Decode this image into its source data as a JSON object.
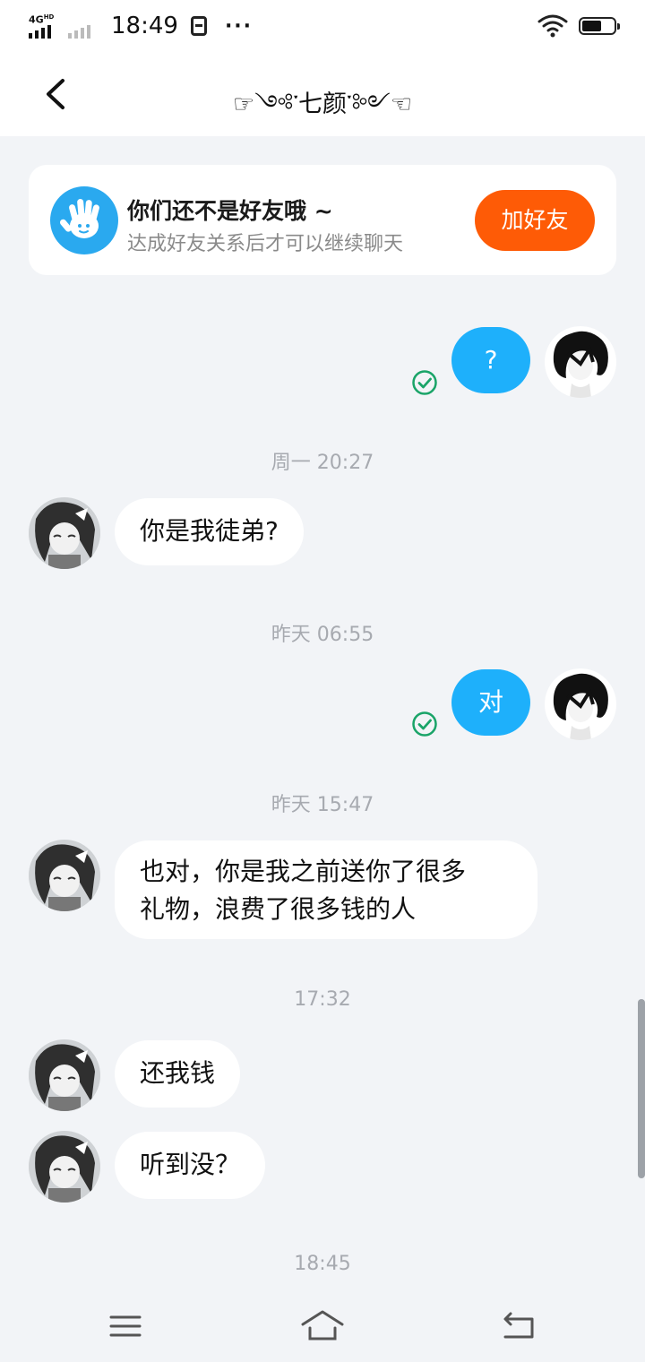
{
  "status_bar": {
    "network": "4G",
    "network_sup": "HD",
    "time": "18:49",
    "more": "···",
    "battery_level": 0.65
  },
  "header": {
    "title": "☞༺་七颜་༻☜"
  },
  "friend_banner": {
    "title": "你们还不是好友哦 ~",
    "subtitle": "达成好友关系后才可以继续聊天",
    "button_label": "加好友"
  },
  "messages": [
    {
      "type": "sent",
      "text": "?"
    },
    {
      "type": "time",
      "text": "周一 20:27"
    },
    {
      "type": "received",
      "text": "你是我徒弟?"
    },
    {
      "type": "time",
      "text": "昨天 06:55"
    },
    {
      "type": "sent",
      "text": "对"
    },
    {
      "type": "time",
      "text": "昨天 15:47"
    },
    {
      "type": "received",
      "text_line1": "也对，你是我之前送你了很多",
      "text_line2": "礼物，浪费了很多钱的人"
    },
    {
      "type": "time",
      "text": "17:32"
    },
    {
      "type": "received",
      "text": "还我钱"
    },
    {
      "type": "received",
      "text": "听到没？"
    },
    {
      "type": "time",
      "text": "18:45"
    }
  ],
  "colors": {
    "background": "#f2f4f7",
    "sent_bubble": "#1eb0fb",
    "add_friend_button": "#fe5b06",
    "read_check": "#1aa468"
  },
  "icons": {
    "back": "chevron-left-icon",
    "banner": "waving-hand-icon",
    "read": "check-circle-icon",
    "menu": "menu-icon",
    "home": "home-icon",
    "return": "back-arrow-icon"
  }
}
